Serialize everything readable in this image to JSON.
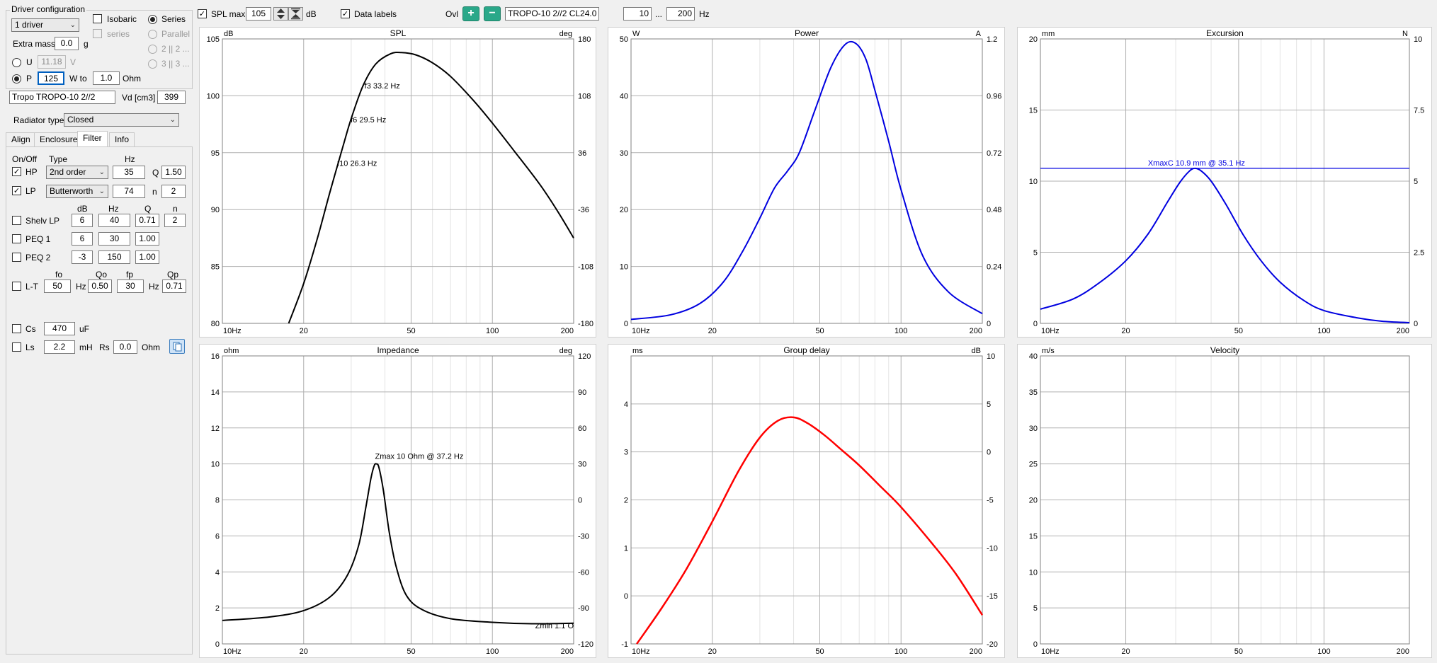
{
  "driver": {
    "group_title": "Driver configuration",
    "count": "1 driver",
    "isobaric": "Isobaric",
    "series_sub": "series",
    "series": "Series",
    "parallel": "Parallel",
    "opt2": "2 || 2 ...",
    "opt3": "3 || 3 ...",
    "extra_mass_label": "Extra mass",
    "extra_mass": "0.0",
    "extra_mass_unit": "g",
    "u_label": "U",
    "u_value": "11.18",
    "u_unit": "V",
    "p_label": "P",
    "p_value": "125",
    "w_to": "W to",
    "ohm_value": "1.0",
    "ohm_unit": "Ohm",
    "name": "Tropo TROPO-10 2//2",
    "vd_label": "Vd [cm3]",
    "vd_value": "399",
    "radiator_label": "Radiator type",
    "radiator_value": "Closed"
  },
  "tabs": [
    "Align",
    "Enclosure",
    "Filter",
    "Info"
  ],
  "filter": {
    "h_onoff": "On/Off",
    "h_type": "Type",
    "h_hz": "Hz",
    "hp_label": "HP",
    "hp_type": "2nd order",
    "hp_hz": "35",
    "hp_q_label": "Q",
    "hp_q": "1.50",
    "lp_label": "LP",
    "lp_type": "Butterworth",
    "lp_hz": "74",
    "lp_n_label": "n",
    "lp_n": "2",
    "h2_db": "dB",
    "h2_hz": "Hz",
    "h2_q": "Q",
    "h2_n": "n",
    "shelv_label": "Shelv LP",
    "shelv_db": "6",
    "shelv_hz": "40",
    "shelv_q": "0.71",
    "shelv_n": "2",
    "peq1_label": "PEQ 1",
    "peq1_db": "6",
    "peq1_hz": "30",
    "peq1_q": "1.00",
    "peq2_label": "PEQ 2",
    "peq2_db": "-3",
    "peq2_hz": "150",
    "peq2_q": "1.00",
    "h3_fo": "fo",
    "h3_qo": "Qo",
    "h3_fp": "fp",
    "h3_qp": "Qp",
    "lt_label": "L-T",
    "lt_fo": "50",
    "lt_hz1": "Hz",
    "lt_qo": "0.50",
    "lt_fp": "30",
    "lt_hz2": "Hz",
    "lt_qp": "0.71",
    "cs_label": "Cs",
    "cs_value": "470",
    "cs_unit": "uF",
    "ls_label": "Ls",
    "ls_value": "2.2",
    "ls_unit": "mH",
    "rs_label": "Rs",
    "rs_value": "0.0",
    "rs_unit": "Ohm"
  },
  "toolbar": {
    "splmax_label": "SPL max",
    "splmax_value": "105",
    "db_unit": "dB",
    "datalabels_label": "Data labels",
    "ovl_label": "Ovl",
    "overlay_name": "TROPO-10 2//2 CL24.0",
    "f_min": "10",
    "dots": "...",
    "f_max": "200",
    "hz_unit": "Hz"
  },
  "colors": {
    "black": "#000000",
    "blue": "#0000e0",
    "red": "#ff0000",
    "green": "#2aa889"
  },
  "chart_data": [
    {
      "type": "line",
      "title": "SPL",
      "ylabel_left": "dB",
      "ylabel_right": "deg",
      "xscale": "log",
      "xlim": [
        10,
        200
      ],
      "ylim": [
        80,
        105
      ],
      "y2lim": [
        -180,
        180
      ],
      "xticks": [
        10,
        20,
        50,
        100,
        200
      ],
      "xtick_labels": [
        "10Hz",
        "20",
        "50",
        "100",
        "200"
      ],
      "yticks": [
        80,
        85,
        90,
        95,
        100,
        105
      ],
      "y2ticks": [
        -180,
        -108,
        -36,
        36,
        108,
        180
      ],
      "series": [
        {
          "color": "#000000",
          "x": [
            17.6,
            20,
            22.5,
            25,
            28,
            30,
            33.2,
            37,
            42,
            46,
            52,
            60,
            70,
            85,
            100,
            120,
            150,
            175,
            200
          ],
          "y": [
            80,
            83.5,
            87.5,
            91.5,
            95.6,
            98,
            100.9,
            102.8,
            103.7,
            103.8,
            103.6,
            102.9,
            101.7,
            99.6,
            97.6,
            95.2,
            92.2,
            89.8,
            87.5
          ]
        }
      ],
      "annotations": [
        {
          "text": "f3 33.2 Hz",
          "x": 33.2,
          "y": 100.9
        },
        {
          "text": "f6 29.5 Hz",
          "x": 29.5,
          "y": 97.9
        },
        {
          "text": "f10 26.3 Hz",
          "x": 26.3,
          "y": 94.1
        }
      ]
    },
    {
      "type": "line",
      "title": "Power",
      "ylabel_left": "W",
      "ylabel_right": "A",
      "xscale": "log",
      "xlim": [
        10,
        200
      ],
      "ylim": [
        0,
        50
      ],
      "y2lim": [
        0,
        1.2
      ],
      "xticks": [
        10,
        20,
        50,
        100,
        200
      ],
      "xtick_labels": [
        "10Hz",
        "20",
        "50",
        "100",
        "200"
      ],
      "yticks": [
        0,
        10,
        20,
        30,
        40,
        50
      ],
      "y2ticks": [
        0,
        0.24,
        0.48,
        0.72,
        0.96,
        1.2
      ],
      "series": [
        {
          "color": "#0000e0",
          "x": [
            10,
            14,
            18,
            22,
            26,
            30,
            34,
            38,
            42,
            48,
            55,
            62,
            68,
            74,
            80,
            90,
            100,
            120,
            150,
            200
          ],
          "y": [
            0.7,
            1.5,
            3.5,
            7.3,
            12.8,
            18.5,
            23.8,
            26.8,
            30,
            37.5,
            45,
            49,
            49.2,
            46.5,
            41,
            32,
            23.5,
            12,
            5.5,
            1.7
          ]
        }
      ]
    },
    {
      "type": "line",
      "title": "Excursion",
      "ylabel_left": "mm",
      "ylabel_right": "N",
      "xscale": "log",
      "xlim": [
        10,
        200
      ],
      "ylim": [
        0,
        20
      ],
      "y2lim": [
        0,
        10
      ],
      "xticks": [
        10,
        20,
        50,
        100,
        200
      ],
      "xtick_labels": [
        "10Hz",
        "20",
        "50",
        "100",
        "200"
      ],
      "yticks": [
        0,
        5,
        10,
        15,
        20
      ],
      "y2ticks": [
        0,
        2.5,
        5,
        7.5,
        10
      ],
      "xmax_line": 10.9,
      "series": [
        {
          "color": "#0000e0",
          "x": [
            10,
            13,
            16,
            20,
            24,
            28,
            31,
            33.5,
            35.1,
            37,
            40,
            45,
            52,
            60,
            70,
            85,
            100,
            130,
            160,
            200
          ],
          "y": [
            1.0,
            1.7,
            2.8,
            4.4,
            6.3,
            8.5,
            9.9,
            10.7,
            10.9,
            10.7,
            10.0,
            8.4,
            6.2,
            4.4,
            2.9,
            1.6,
            0.9,
            0.4,
            0.15,
            0.05
          ]
        }
      ],
      "annotations": [
        {
          "text": "XmaxC 10.9 mm  @ 35.1 Hz",
          "x": 35.1,
          "y": 10.9
        }
      ]
    },
    {
      "type": "line",
      "title": "Impedance",
      "ylabel_left": "ohm",
      "ylabel_right": "deg",
      "xscale": "log",
      "xlim": [
        10,
        200
      ],
      "ylim": [
        0,
        16
      ],
      "y2lim": [
        -120,
        120
      ],
      "xticks": [
        10,
        20,
        50,
        100,
        200
      ],
      "xtick_labels": [
        "10Hz",
        "20",
        "50",
        "100",
        "200"
      ],
      "yticks": [
        0,
        2,
        4,
        6,
        8,
        10,
        12,
        14,
        16
      ],
      "y2ticks": [
        -120,
        -90,
        -60,
        -30,
        0,
        30,
        60,
        90,
        120
      ],
      "series": [
        {
          "color": "#000000",
          "x": [
            10,
            15,
            20,
            25,
            29,
            32,
            34,
            35.5,
            36.5,
            37.2,
            38,
            39.5,
            41.5,
            44,
            48,
            55,
            70,
            100,
            140,
            200
          ],
          "y": [
            1.3,
            1.5,
            1.85,
            2.6,
            3.8,
            5.5,
            7.6,
            9.2,
            9.9,
            10,
            9.8,
            8.5,
            6.2,
            4.3,
            2.7,
            1.9,
            1.4,
            1.2,
            1.12,
            1.15
          ]
        }
      ],
      "annotations": [
        {
          "text": "Zmax 10 Ohm @ 37.2 Hz",
          "x": 37.2,
          "y": 10
        },
        {
          "text": "Zmin 1.1 O",
          "x": 200,
          "y": 1.1
        }
      ]
    },
    {
      "type": "line",
      "title": "Group delay",
      "ylabel_left": "ms",
      "ylabel_right": "dB",
      "xscale": "log",
      "xlim": [
        10,
        200
      ],
      "ylim": [
        -1,
        5
      ],
      "y2lim": [
        -20,
        10
      ],
      "xticks": [
        10,
        20,
        50,
        100,
        200
      ],
      "xtick_labels": [
        "10Hz",
        "20",
        "50",
        "100",
        "200"
      ],
      "yticks": [
        -1,
        0,
        1,
        2,
        3,
        4
      ],
      "y2ticks": [
        -20,
        -15,
        -10,
        -5,
        0,
        5,
        10
      ],
      "series": [
        {
          "color": "#ff0000",
          "x": [
            10.5,
            13,
            16,
            20,
            25,
            30,
            35,
            40,
            45,
            52,
            60,
            70,
            85,
            100,
            130,
            160,
            200
          ],
          "y": [
            -1,
            -0.25,
            0.55,
            1.55,
            2.6,
            3.3,
            3.65,
            3.72,
            3.6,
            3.35,
            3.05,
            2.72,
            2.25,
            1.85,
            1.1,
            0.45,
            -0.4
          ]
        }
      ]
    },
    {
      "type": "line",
      "title": "Velocity",
      "ylabel_left": "m/s",
      "xscale": "log",
      "xlim": [
        10,
        200
      ],
      "ylim": [
        0,
        40
      ],
      "xticks": [
        10,
        20,
        50,
        100,
        200
      ],
      "xtick_labels": [
        "10Hz",
        "20",
        "50",
        "100",
        "200"
      ],
      "yticks": [
        0,
        5,
        10,
        15,
        20,
        25,
        30,
        35,
        40
      ],
      "series": []
    }
  ]
}
